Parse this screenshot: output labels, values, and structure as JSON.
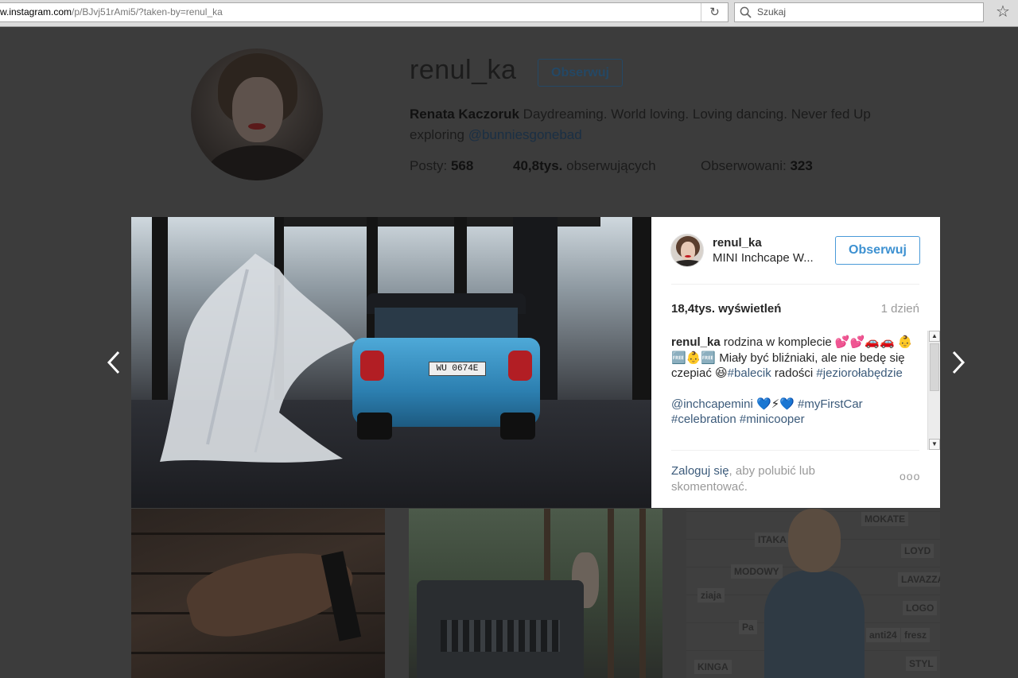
{
  "browser": {
    "url_host": "w.instagram.com",
    "url_path": "/p/BJvj51rAmi5/?taken-by=renul_ka",
    "search_placeholder": "Szukaj",
    "reload_icon": "reload-icon",
    "bookmark_icon": "star-icon"
  },
  "profile": {
    "username": "renul_ka",
    "follow_label": "Obserwuj",
    "full_name": "Renata Kaczoruk",
    "bio_text": " Daydreaming. World loving. Loving dancing. Never fed Up exploring ",
    "bio_link": "@bunniesgonebad",
    "stats": {
      "posts_label": "Posty: ",
      "posts_value": "568",
      "followers_value": "40,8tys.",
      "followers_label": " obserwujących",
      "following_label": "Obserwowani: ",
      "following_value": "323"
    }
  },
  "post": {
    "username": "renul_ka",
    "location": "MINI Inchcape W...",
    "follow_label": "Obserwuj",
    "views": "18,4tys. wyświetleń",
    "age": "1 dzień",
    "plate": "WU 0674E",
    "caption": {
      "author": "renul_ka",
      "text1": " rodzina w komplecie 💕💕🚗🚗 👶🆓👶🆓 Miały być bliźniaki, ale nie bedę się czepiać 😆",
      "tag1": "#balecik",
      "text2": " radości ",
      "tag2": "#jeziorołabędzie",
      "mention": "@inchcapemini",
      "text3": " 💙⚡💙 ",
      "tag3": "#myFirstCar",
      "tag4": "#celebration",
      "tag5": "#minicooper"
    },
    "login_link": "Zaloguj się",
    "login_text": ", aby polubić lub skomentować.",
    "more": "ooo"
  },
  "thumbnails": {
    "t3_logos": [
      "MOKATE",
      "ITAKA",
      "LOYD",
      "LAVAZZA",
      "LOGO",
      "ziaja",
      "MODOWY",
      "Pa",
      "anti24",
      "fresz",
      "STYL",
      "KINGA"
    ]
  }
}
